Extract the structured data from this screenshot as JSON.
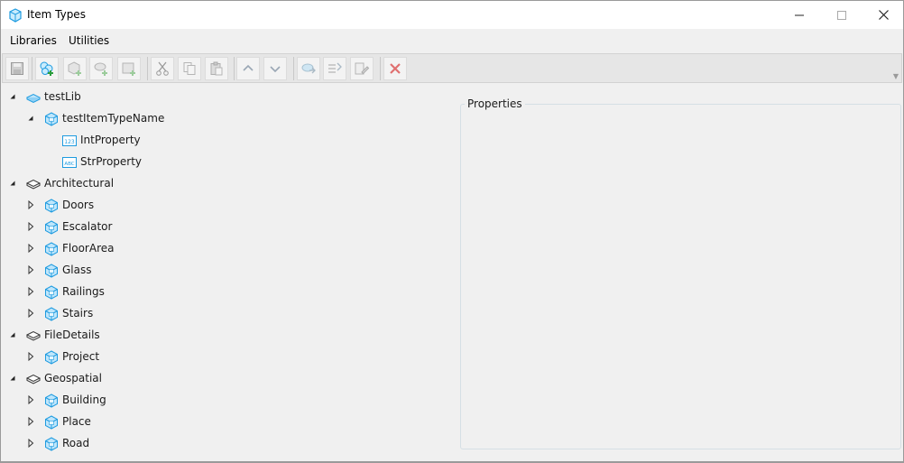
{
  "window": {
    "title": "Item Types"
  },
  "menu": {
    "libraries": "Libraries",
    "utilities": "Utilities"
  },
  "toolbar": {
    "buttons": [
      {
        "name": "save",
        "icon": "save-icon"
      },
      {
        "name": "add-library",
        "icon": "add-library-icon"
      },
      {
        "name": "add-item-type",
        "icon": "add-item-type-icon"
      },
      {
        "name": "add-property",
        "icon": "add-property-icon"
      },
      {
        "name": "add-custom",
        "icon": "add-custom-icon"
      },
      {
        "name": "cut",
        "icon": "cut-icon"
      },
      {
        "name": "copy",
        "icon": "copy-icon"
      },
      {
        "name": "paste",
        "icon": "paste-icon"
      },
      {
        "name": "move-up",
        "icon": "arrow-up-icon"
      },
      {
        "name": "move-down",
        "icon": "arrow-down-icon"
      },
      {
        "name": "import",
        "icon": "import-icon"
      },
      {
        "name": "rename",
        "icon": "rename-icon"
      },
      {
        "name": "edit",
        "icon": "edit-icon"
      },
      {
        "name": "delete",
        "icon": "delete-icon"
      }
    ]
  },
  "tree": {
    "items": [
      {
        "label": "testLib",
        "level": 0,
        "expander": "expanded",
        "icon": "library-blue"
      },
      {
        "label": "testItemTypeName",
        "level": 1,
        "expander": "expanded",
        "icon": "itemtype"
      },
      {
        "label": "IntProperty",
        "level": 2,
        "expander": "none",
        "icon": "int-prop"
      },
      {
        "label": "StrProperty",
        "level": 2,
        "expander": "none",
        "icon": "str-prop"
      },
      {
        "label": "Architectural",
        "level": 0,
        "expander": "expanded",
        "icon": "library-gray"
      },
      {
        "label": "Doors",
        "level": 1,
        "expander": "collapsed",
        "icon": "itemtype"
      },
      {
        "label": "Escalator",
        "level": 1,
        "expander": "collapsed",
        "icon": "itemtype"
      },
      {
        "label": "FloorArea",
        "level": 1,
        "expander": "collapsed",
        "icon": "itemtype"
      },
      {
        "label": "Glass",
        "level": 1,
        "expander": "collapsed",
        "icon": "itemtype"
      },
      {
        "label": "Railings",
        "level": 1,
        "expander": "collapsed",
        "icon": "itemtype"
      },
      {
        "label": "Stairs",
        "level": 1,
        "expander": "collapsed",
        "icon": "itemtype"
      },
      {
        "label": "FileDetails",
        "level": 0,
        "expander": "expanded",
        "icon": "library-gray"
      },
      {
        "label": "Project",
        "level": 1,
        "expander": "collapsed",
        "icon": "itemtype"
      },
      {
        "label": "Geospatial",
        "level": 0,
        "expander": "expanded",
        "icon": "library-gray"
      },
      {
        "label": "Building",
        "level": 1,
        "expander": "collapsed",
        "icon": "itemtype"
      },
      {
        "label": "Place",
        "level": 1,
        "expander": "collapsed",
        "icon": "itemtype"
      },
      {
        "label": "Road",
        "level": 1,
        "expander": "collapsed",
        "icon": "itemtype"
      }
    ],
    "int_badge": "123",
    "str_badge": "ABC"
  },
  "properties": {
    "title": "Properties"
  },
  "colors": {
    "accent": "#1e9be0",
    "itemtype_fill": "#bfe6fb",
    "delete_red": "#e05050"
  }
}
